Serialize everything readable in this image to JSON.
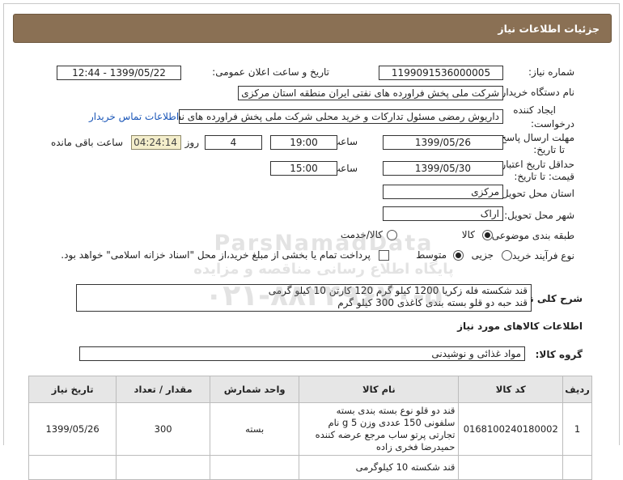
{
  "header": {
    "title": "جزئیات اطلاعات نیاز"
  },
  "form": {
    "need_number_label": "شماره نیاز:",
    "need_number": "1199091536000005",
    "announce_label": "تاریخ و ساعت اعلان عمومی:",
    "announce_value": "1399/05/22 - 12:44",
    "buyer_label": "نام دستگاه خریدار:",
    "buyer_value": "شرکت ملی پخش فراورده های نفتی ایران منطقه استان مرکزی",
    "creator_label_1": "ایجاد کننده",
    "creator_label_2": "درخواست:",
    "creator_value": "داریوش رمضی مسئول تدارکات و خرید محلی شرکت ملی پخش فراورده های نفتی",
    "contact_link": "اطلاعات تماس خریدار",
    "deadline_label_1": "مهلت ارسال پاسخ:",
    "deadline_label_2": "تا تاریخ:",
    "deadline_date": "1399/05/26",
    "time_label": "ساعت",
    "deadline_time": "19:00",
    "days_value": "4",
    "days_label": "روز و",
    "remaining_time": "04:24:14",
    "remaining_label": "ساعت باقی مانده",
    "validity_label_1": "حداقل تاریخ اعتبار",
    "validity_label_2": "قیمت: تا تاریخ:",
    "validity_date": "1399/05/30",
    "validity_time_label": "ساعت",
    "validity_time": "15:00",
    "province_label": "استان محل تحویل:",
    "province_value": "مرکزی",
    "city_label": "شهر محل تحویل:",
    "city_value": "اراک",
    "category_label": "طبقه بندی موضوعی:",
    "category_options": [
      "کالا",
      "کالا/خدمت"
    ],
    "category_selected": "کالا",
    "purchase_type_label": "نوع فرآیند خرید :",
    "purchase_options": [
      "جزیی",
      "متوسط"
    ],
    "purchase_selected": "متوسط",
    "payment_note": "پرداخت تمام یا بخشی از مبلغ خرید،از محل \"اسناد خزانه اسلامی\" خواهد بود.",
    "summary_label": "شرح کلی نیاز:",
    "summary_line_1": "قند شکسته فله زکریا 1200  کیلو گرم  120 کارتن  10  کیلو گرمی",
    "summary_line_2": "قند حبه دو قلو بسته بندی کاغذی  300  کیلو گرم"
  },
  "goods": {
    "section_title": "اطلاعات کالاهای مورد نیاز",
    "group_label": "گروه کالا:",
    "group_value": "مواد غذائی و نوشیدنی",
    "columns": [
      "ردیف",
      "کد کالا",
      "نام کالا",
      "واحد شمارش",
      "مقدار / تعداد",
      "تاریخ نیاز"
    ],
    "rows": [
      {
        "index": "1",
        "code": "0168100240180002",
        "name": "قند دو قلو نوع بسته بندی بسته سلفونی 150 عددی وزن 5 g نام تجارتی پرتو ساب مرجع عرضه کننده حمیدرضا فخری زاده",
        "unit": "بسته",
        "qty": "300",
        "date": "1399/05/26"
      },
      {
        "index": "",
        "code": "",
        "name": "قند شکسته 10 کیلوگرمی",
        "unit": "",
        "qty": "",
        "date": ""
      }
    ]
  },
  "watermark": {
    "line1": "ParsNamadData",
    "line2": "پایگاه اطلاع رسانی مناقصه و مزایده",
    "line3": "۰۲۱-۸۸۳۴۹۶۷۰-۵"
  }
}
